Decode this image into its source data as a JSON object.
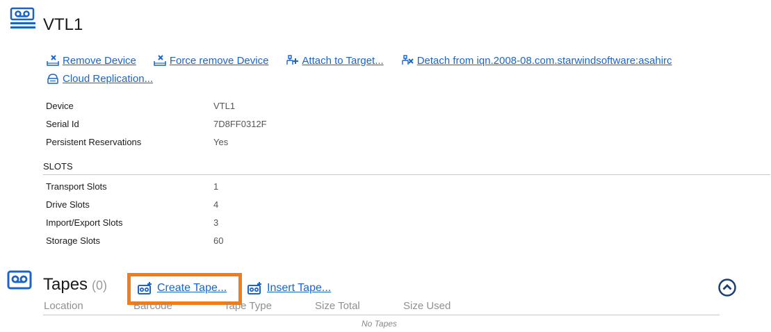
{
  "device": {
    "title": "VTL1",
    "icon": "tape-library-icon"
  },
  "actions": {
    "remove_device": "Remove Device",
    "force_remove_device": "Force remove Device",
    "attach_target": "Attach to Target...",
    "detach": "Detach from iqn.2008-08.com.starwindsoftware:asahirc",
    "cloud_replication": "Cloud Replication..."
  },
  "properties": [
    {
      "label": "Device",
      "value": "VTL1"
    },
    {
      "label": "Serial Id",
      "value": "7D8FF0312F"
    },
    {
      "label": "Persistent Reservations",
      "value": "Yes"
    }
  ],
  "slots": {
    "heading": "SLOTS",
    "items": [
      {
        "label": "Transport Slots",
        "value": "1"
      },
      {
        "label": "Drive Slots",
        "value": "4"
      },
      {
        "label": "Import/Export Slots",
        "value": "3"
      },
      {
        "label": "Storage Slots",
        "value": "60"
      }
    ]
  },
  "tapes": {
    "title": "Tapes",
    "count": "(0)",
    "create_label": "Create Tape...",
    "insert_label": "Insert Tape...",
    "columns": [
      "Location",
      "Barcode",
      "Tape Type",
      "Size Total",
      "Size Used"
    ],
    "empty_text": "No Tapes"
  },
  "colors": {
    "link": "#1a64c8",
    "highlight": "#f07d1b"
  }
}
